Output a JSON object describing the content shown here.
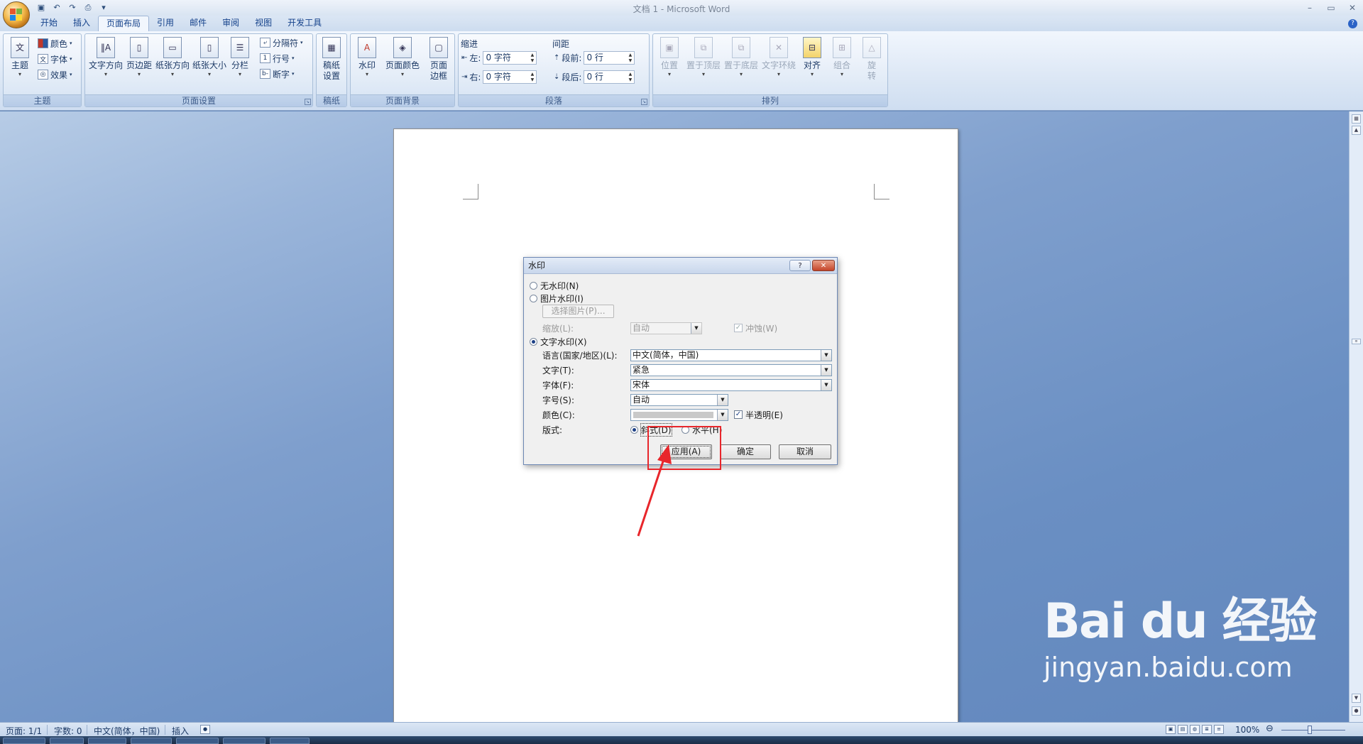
{
  "window": {
    "title": "文档 1 - Microsoft Word",
    "controls": [
      "–",
      "▭",
      "✕"
    ]
  },
  "quick_access": {
    "items": [
      {
        "name": "save-icon",
        "glyph": "▣"
      },
      {
        "name": "undo-icon",
        "glyph": "↶"
      },
      {
        "name": "redo-icon",
        "glyph": "↷"
      },
      {
        "name": "print-preview-icon",
        "glyph": "⎙"
      },
      {
        "name": "customize-icon",
        "glyph": "▾"
      }
    ]
  },
  "tabs": [
    "开始",
    "插入",
    "页面布局",
    "引用",
    "邮件",
    "审阅",
    "视图",
    "开发工具"
  ],
  "active_tab": "页面布局",
  "ribbon": {
    "theme": {
      "label": "主题",
      "big_button": "主题",
      "colors": "颜色",
      "fonts": "字体",
      "effects": "效果"
    },
    "page_setup": {
      "label": "页面设置",
      "text_direction": "文字方向",
      "margins": "页边距",
      "orientation": "纸张方向",
      "size": "纸张大小",
      "columns": "分栏",
      "breaks": "分隔符",
      "line_numbers": "行号",
      "hyphenation": "断字"
    },
    "manuscript": {
      "label": "稿纸",
      "button_line1": "稿纸",
      "button_line2": "设置"
    },
    "page_background": {
      "label": "页面背景",
      "watermark": "水印",
      "page_color": "页面颜色",
      "borders_line1": "页面",
      "borders_line2": "边框"
    },
    "paragraph": {
      "label": "段落",
      "indent_title": "缩进",
      "spacing_title": "间距",
      "left_label": "左:",
      "right_label": "右:",
      "left_value": "0 字符",
      "right_value": "0 字符",
      "before_label": "段前:",
      "after_label": "段后:",
      "before_value": "0 行",
      "after_value": "0 行"
    },
    "arrange": {
      "label": "排列",
      "position": "位置",
      "bring_front": "置于顶层",
      "send_back": "置于底层",
      "text_wrap": "文字环绕",
      "align": "对齐",
      "group": "组合",
      "rotate_line1": "旋",
      "rotate_line2": "转"
    }
  },
  "dialog": {
    "title": "水印",
    "help": "?",
    "close": "✕",
    "no_watermark": "无水印(N)",
    "picture_watermark": "图片水印(I)",
    "select_picture": "选择图片(P)...",
    "scale_label": "缩放(L):",
    "scale_value": "自动",
    "washout": "冲蚀(W)",
    "text_watermark": "文字水印(X)",
    "language_label": "语言(国家/地区)(L):",
    "language_value": "中文(简体，中国)",
    "text_label": "文字(T):",
    "text_value": "紧急",
    "font_label": "字体(F):",
    "font_value": "宋体",
    "size_label": "字号(S):",
    "size_value": "自动",
    "color_label": "颜色(C):",
    "semitransparent": "半透明(E)",
    "layout_label": "版式:",
    "diagonal": "斜式(D)",
    "horizontal": "水平(H)",
    "apply": "应用(A)",
    "ok": "确定",
    "cancel": "取消",
    "selected_type": "文字水印",
    "selected_layout": "斜式"
  },
  "statusbar": {
    "page": "页面: 1/1",
    "words": "字数: 0",
    "language": "中文(简体，中国)",
    "mode": "插入",
    "zoom": "100%"
  },
  "watermark_brand": {
    "logo": "Bai du 经验",
    "url": "jingyan.baidu.com"
  },
  "colors": {
    "accent": "#15428b",
    "highlight": "#e8262b"
  }
}
